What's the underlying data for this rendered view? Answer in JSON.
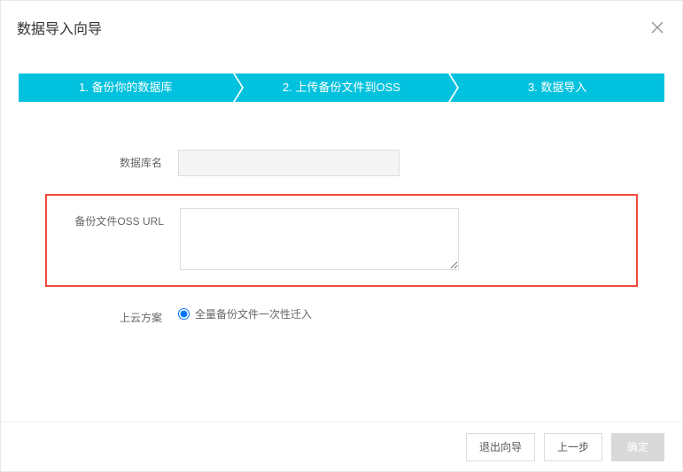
{
  "dialog": {
    "title": "数据导入向导"
  },
  "steps": [
    {
      "label": "1. 备份你的数据库"
    },
    {
      "label": "2. 上传备份文件到OSS"
    },
    {
      "label": "3. 数据导入"
    }
  ],
  "form": {
    "db_name_label": "数据库名",
    "db_name_value": "",
    "oss_url_label": "备份文件OSS URL",
    "oss_url_value": "",
    "plan_label": "上云方案",
    "plan_option": "全量备份文件一次性迁入"
  },
  "footer": {
    "exit_label": "退出向导",
    "prev_label": "上一步",
    "ok_label": "确定"
  }
}
